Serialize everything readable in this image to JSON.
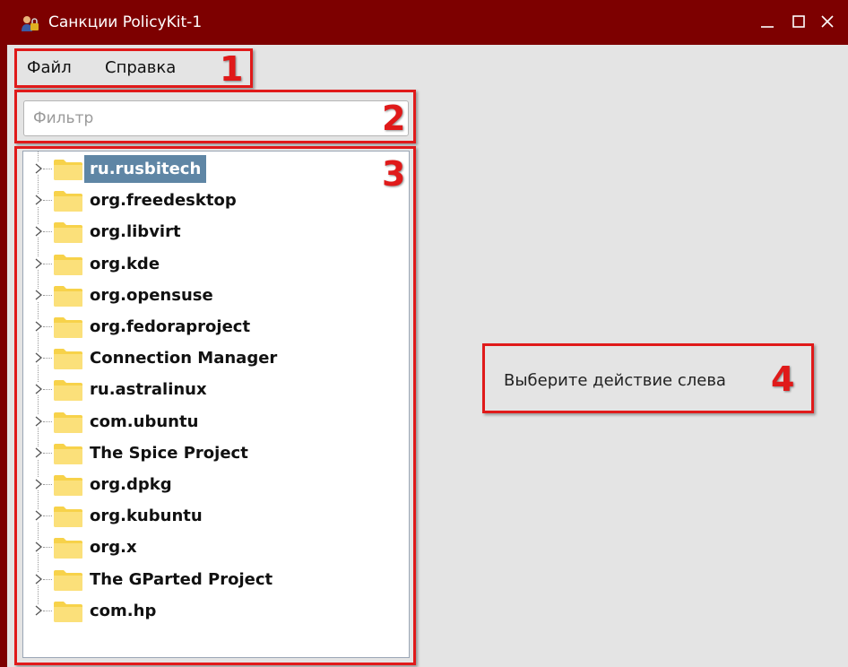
{
  "window": {
    "title": "Санкции PolicyKit-1",
    "icon": "policykit-user-lock-icon",
    "controls": [
      "minimize-icon",
      "maximize-icon",
      "close-icon"
    ]
  },
  "menu": {
    "file": "Файл",
    "help": "Справка"
  },
  "filter": {
    "placeholder": "Фильтр",
    "value": ""
  },
  "tree": {
    "selected_index": 0,
    "items": [
      {
        "label": "ru.rusbitech"
      },
      {
        "label": "org.freedesktop"
      },
      {
        "label": "org.libvirt"
      },
      {
        "label": "org.kde"
      },
      {
        "label": "org.opensuse"
      },
      {
        "label": "org.fedoraproject"
      },
      {
        "label": "Connection Manager"
      },
      {
        "label": "ru.astralinux"
      },
      {
        "label": "com.ubuntu"
      },
      {
        "label": "The Spice Project"
      },
      {
        "label": "org.dpkg"
      },
      {
        "label": "org.kubuntu"
      },
      {
        "label": "org.x"
      },
      {
        "label": "The GParted Project"
      },
      {
        "label": "com.hp"
      }
    ]
  },
  "details": {
    "hint": "Выберите действие слева"
  },
  "annotations": {
    "n1": "1",
    "n2": "2",
    "n3": "3",
    "n4": "4"
  },
  "colors": {
    "titlebar": "#7d0000",
    "annotation": "#e01a1a",
    "selection": "#5f86a5",
    "folder": "#f7d24a"
  }
}
